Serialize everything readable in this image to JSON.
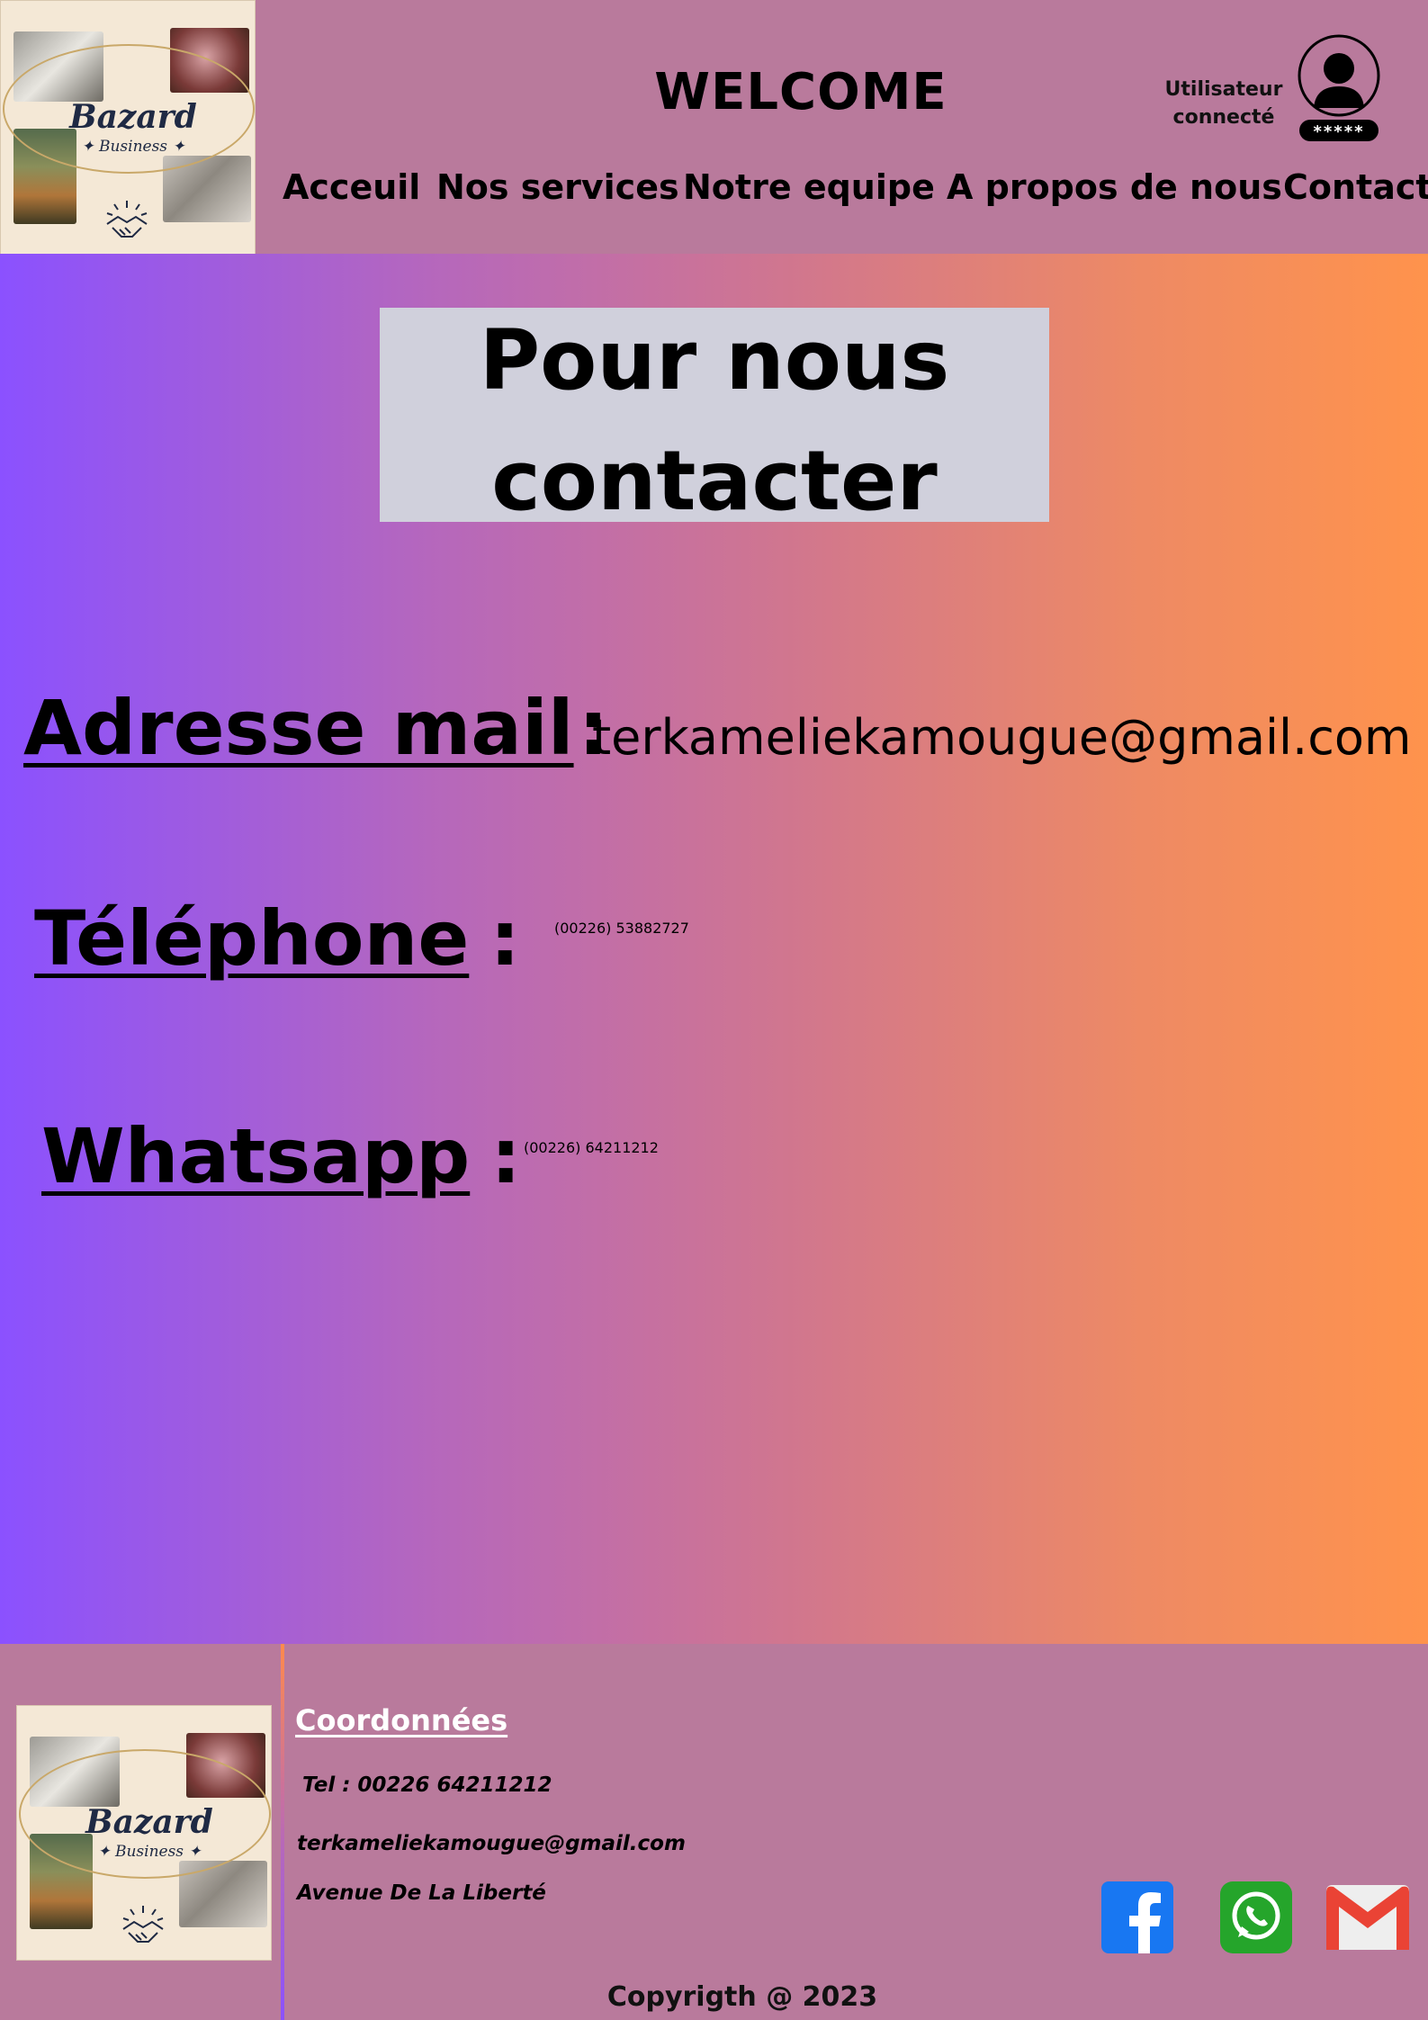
{
  "header": {
    "logo": {
      "brand": "Bazard",
      "sub": "✦ Business ✦"
    },
    "welcome": "WELCOME",
    "user": {
      "line1": "Utilisateur",
      "line2": "connecté",
      "password_mask": "*****"
    },
    "nav": [
      "Acceuil",
      "Nos services",
      "Notre equipe",
      "A propos de nous",
      "Contact"
    ]
  },
  "main": {
    "title_line1": "Pour nous",
    "title_line2": "contacter",
    "email": {
      "label": "Adresse mail",
      "colon": ":",
      "value": "terkameliekamougue@gmail.com"
    },
    "phone": {
      "label": "Téléphone",
      "colon": ":",
      "value": "(00226) 53882727"
    },
    "whatsapp": {
      "label": "Whatsapp",
      "colon": ":",
      "value": "(00226) 64211212"
    }
  },
  "footer": {
    "logo": {
      "brand": "Bazard",
      "sub": "✦ Business ✦"
    },
    "coord_title": "Coordonnées",
    "tel": "Tel : 00226 64211212",
    "email": "terkameliekamougue@gmail.com",
    "address": "Avenue De La Liberté",
    "copyright": "Copyrigth @ 2023",
    "social": [
      {
        "icon": "facebook-icon",
        "color": "#1877f2"
      },
      {
        "icon": "whatsapp-icon",
        "color": "#25a52b"
      },
      {
        "icon": "gmail-icon",
        "color": "#ea4335"
      }
    ]
  },
  "colors": {
    "bar": "#b97a9c",
    "gradient_start": "#8b51ff",
    "gradient_end": "#ff934c",
    "title_box": "#d0d0dc"
  }
}
